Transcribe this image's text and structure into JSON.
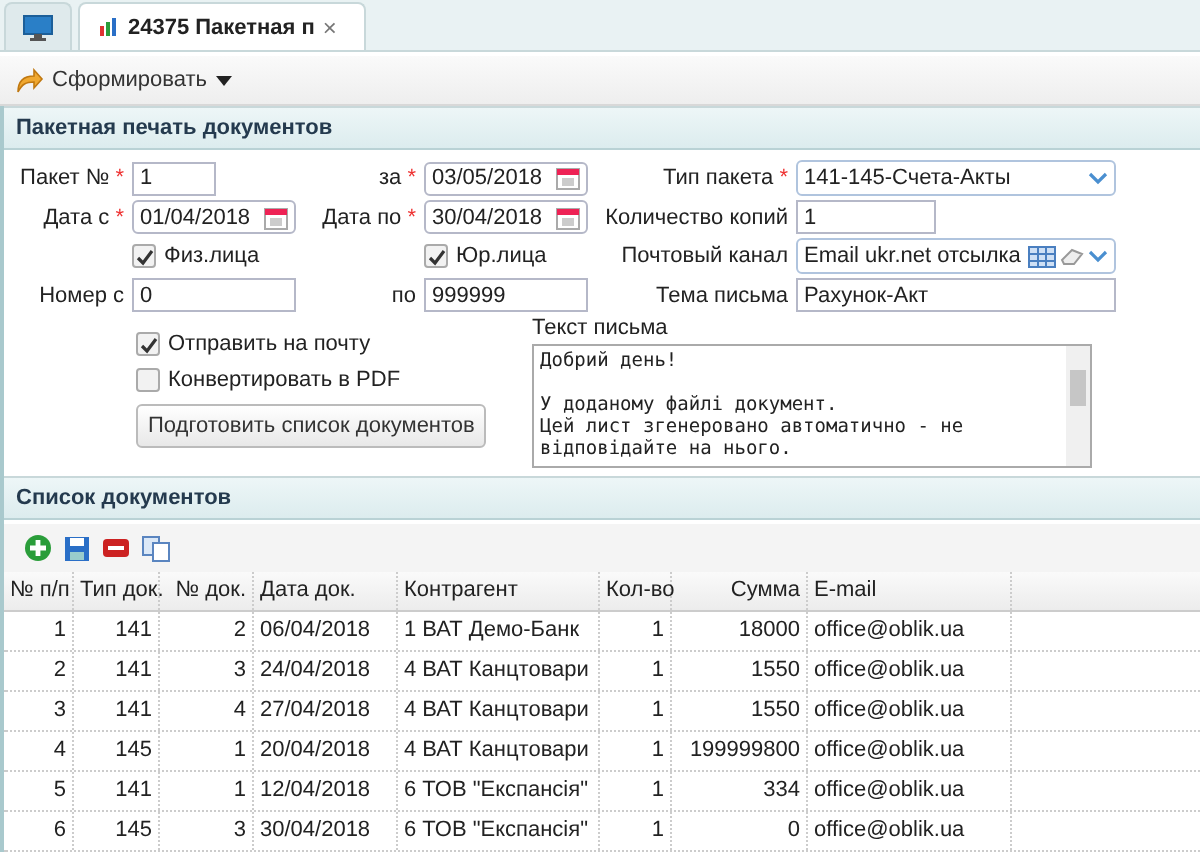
{
  "tabs": [
    {
      "kind": "home",
      "selected": false
    },
    {
      "kind": "doc",
      "label": "24375 Пакетная п",
      "close": "×",
      "selected": true
    }
  ],
  "toolbar": {
    "button": "Сформировать"
  },
  "form_panel": {
    "title": "Пакетная печать документов",
    "package_no": {
      "label": "Пакет №",
      "required_mark": "*",
      "value": "1"
    },
    "date_for": {
      "label": "за",
      "required_mark": "*",
      "value": "03/05/2018"
    },
    "package_type": {
      "label": "Тип пакета",
      "required_mark": "*",
      "value": "141-145-Счета-Акты"
    },
    "date_from": {
      "label": "Дата с",
      "required_mark": "*",
      "value": "01/04/2018"
    },
    "date_to": {
      "label": "Дата по",
      "required_mark": "*",
      "value": "30/04/2018"
    },
    "copies": {
      "label": "Количество копий",
      "value": "1"
    },
    "individuals": {
      "label": "Физ.лица",
      "checked": true
    },
    "legal": {
      "label": "Юр.лица",
      "checked": true
    },
    "mail_channel": {
      "label": "Почтовый канал",
      "value": "Email ukr.net отсылка"
    },
    "number_from": {
      "label": "Номер с",
      "value": "0"
    },
    "number_to": {
      "label": "по",
      "value": "999999"
    },
    "subject": {
      "label": "Тема письма",
      "value": "Рахунок-Акт"
    },
    "send_mail": {
      "label": "Отправить на почту",
      "checked": true
    },
    "convert_pdf": {
      "label": "Конвертировать в PDF",
      "checked": false
    },
    "prepare_button": "Подготовить список документов",
    "message": {
      "label": "Текст письма",
      "value": "Добрий день!\n\nУ доданому файлі документ.\nЦей лист згенеровано автоматично - не відповідайте на нього."
    }
  },
  "list_panel": {
    "title": "Список документов",
    "columns": [
      "№ п/п",
      "Тип док.",
      "№ док.",
      "Дата док.",
      "Контрагент",
      "Кол-во",
      "Сумма",
      "E-mail"
    ],
    "rows": [
      [
        "1",
        "141",
        "2",
        "06/04/2018",
        "1 ВАТ Демо-Банк",
        "1",
        "18000",
        "office@oblik.ua"
      ],
      [
        "2",
        "141",
        "3",
        "24/04/2018",
        "4 ВАТ Канцтовари",
        "1",
        "1550",
        "office@oblik.ua"
      ],
      [
        "3",
        "141",
        "4",
        "27/04/2018",
        "4 ВАТ Канцтовари",
        "1",
        "1550",
        "office@oblik.ua"
      ],
      [
        "4",
        "145",
        "1",
        "20/04/2018",
        "4 ВАТ Канцтовари",
        "1",
        "199999800",
        "office@oblik.ua"
      ],
      [
        "5",
        "141",
        "1",
        "12/04/2018",
        "6 ТОВ \"Експансія\"",
        "1",
        "334",
        "office@oblik.ua"
      ],
      [
        "6",
        "145",
        "3",
        "30/04/2018",
        "6 ТОВ \"Експансія\"",
        "1",
        "0",
        "office@oblik.ua"
      ]
    ]
  }
}
